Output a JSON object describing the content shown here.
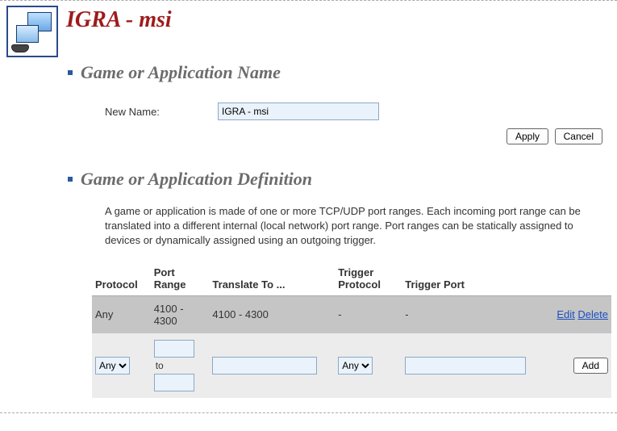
{
  "title": "IGRA - msi",
  "sections": {
    "name_heading": "Game or Application Name",
    "def_heading": "Game or Application Definition"
  },
  "name_form": {
    "label": "New Name:",
    "value": "IGRA - msi",
    "apply": "Apply",
    "cancel": "Cancel"
  },
  "definition": {
    "description": "A game or application is made of one or more TCP/UDP port ranges. Each incoming port range can be translated into a different internal (local network) port range. Port ranges can be statically assigned to devices or dynamically assigned using an outgoing trigger.",
    "headers": {
      "protocol": "Protocol",
      "port_range": "Port Range",
      "translate": "Translate To ...",
      "trigger_protocol": "Trigger Protocol",
      "trigger_port": "Trigger Port"
    },
    "rows": [
      {
        "protocol": "Any",
        "port_range": "4100 - 4300",
        "translate": "4100 - 4300",
        "trigger_protocol": "-",
        "trigger_port": "-",
        "edit": "Edit",
        "delete": "Delete"
      }
    ],
    "input_row": {
      "protocol_options": [
        "Any"
      ],
      "protocol_selected": "Any",
      "range_separator": "to",
      "trigger_protocol_options": [
        "Any"
      ],
      "trigger_protocol_selected": "Any",
      "add": "Add"
    }
  }
}
